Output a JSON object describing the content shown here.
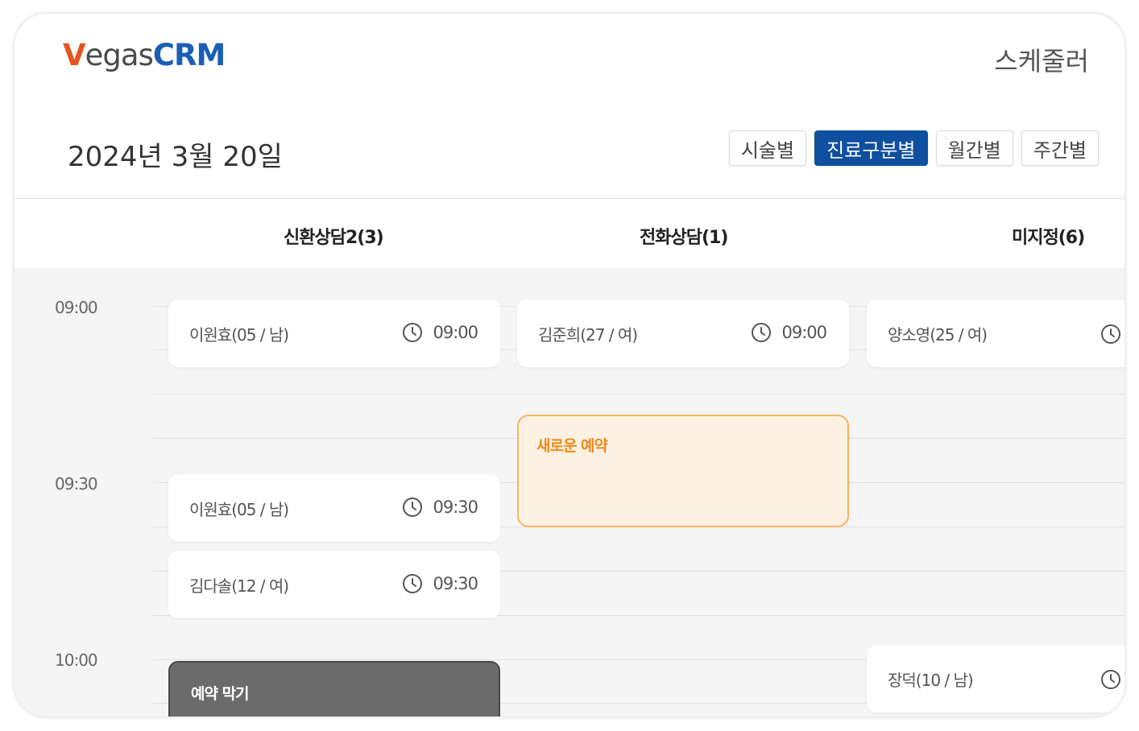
{
  "app": {
    "logo_v": "V",
    "logo_egas": "egas",
    "logo_crm": "CRM",
    "page_title": "스케줄러"
  },
  "date": "2024년 3월 20일",
  "view_tabs": [
    {
      "label": "시술별",
      "active": false
    },
    {
      "label": "진료구분별",
      "active": true
    },
    {
      "label": "월간별",
      "active": false
    },
    {
      "label": "주간별",
      "active": false
    }
  ],
  "columns": [
    "신환상담2(3)",
    "전화상담(1)",
    "미지정(6)"
  ],
  "times": [
    "09:00",
    "09:30",
    "10:00"
  ],
  "appointments": [
    {
      "column": "신환상담2(3)",
      "name": "이원효(05 / 남)",
      "time": "09:00"
    },
    {
      "column": "전화상담(1)",
      "name": "김준희(27 / 여)",
      "time": "09:00"
    },
    {
      "column": "미지정(6)",
      "name": "양소영(25 / 여)",
      "time": ""
    },
    {
      "column": "신환상담2(3)",
      "name": "이원효(05 / 남)",
      "time": "09:30"
    },
    {
      "column": "신환상담2(3)",
      "name": "김다솔(12 / 여)",
      "time": "09:30"
    },
    {
      "column": "미지정(6)",
      "name": "장덕(10 / 남)",
      "time": ""
    }
  ],
  "new_booking_label": "새로운 예약",
  "block_booking_label": "예약 막기",
  "colors": {
    "accent": "#0e4fa0",
    "new_booking_border": "#f6b463",
    "new_booking_bg": "#fdf1e3",
    "new_booking_text": "#ef8a1a",
    "block_bg": "#6b6b6b"
  },
  "icons": {
    "appointment_time": "clock-icon"
  }
}
